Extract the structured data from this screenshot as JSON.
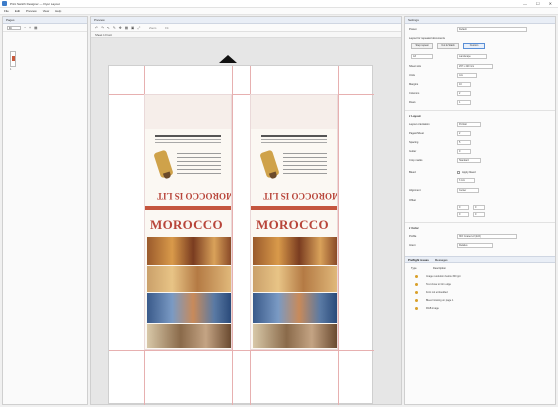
{
  "window": {
    "title": "Print Switch Designer — Flyer Layout",
    "controls": [
      "—",
      "☐",
      "✕"
    ]
  },
  "menu": [
    "File",
    "Edit",
    "Preview",
    "View",
    "Help"
  ],
  "pages_panel": {
    "title": "Pages",
    "zoom_value": "Fit",
    "thumb_label": "1"
  },
  "preview_panel": {
    "title": "Preview",
    "toolbar_glyphs": [
      "↶",
      "↷",
      "↖",
      "✎",
      "✥",
      "▦",
      "▣",
      "⤢"
    ],
    "zoom_label_a": "Zoom",
    "zoom_label_b": "Fit",
    "subbar_label": "Sheet 1 Front"
  },
  "flyers": [
    {
      "name": "flyer-left",
      "heading": "MOROCCO",
      "red_heading": "MOROCCO IS LIT"
    },
    {
      "name": "flyer-right",
      "heading": "MOROCCO",
      "red_heading": "MOROCCO IS LIT"
    }
  ],
  "props_panel": {
    "title": "Settings",
    "rows": [
      {
        "name": "preset-row",
        "label": "Preset",
        "value": "Default"
      },
      {
        "name": "layout-mode-row",
        "label": "Layout for repeated documents",
        "value": ""
      }
    ],
    "buttons": [
      "Step repeat",
      "Cut & Stack",
      "Custom"
    ],
    "sheet_selects": [
      "A3",
      "Landscape"
    ],
    "fields": [
      {
        "label": "Sheet size",
        "value": "297 x 420 mm"
      },
      {
        "label": "Units",
        "value": "mm"
      },
      {
        "label": "Margins",
        "value": "10"
      },
      {
        "label": "Columns",
        "value": "2"
      },
      {
        "label": "Rows",
        "value": "1"
      }
    ],
    "section_layout": "Layout",
    "layout_fields": [
      {
        "label": "Layout orientation",
        "value": "Portrait"
      },
      {
        "label": "Pages/Sheet",
        "value": "2"
      },
      {
        "label": "Spacing",
        "value": "5"
      },
      {
        "label": "Gutter",
        "value": "0"
      },
      {
        "label": "Crop marks",
        "value": "Standard"
      }
    ],
    "bleed_label": "Bleed",
    "bleed_check": "Apply bleed",
    "bleed_value": "3 mm",
    "align_label": "Alignment",
    "align_value": "Center",
    "margin_label": "Offset",
    "margin_values": [
      "0",
      "0",
      "0",
      "0"
    ],
    "section_color": "Color",
    "color_fields": [
      {
        "label": "Profile",
        "value": "ISO Coated v2 (ECI)"
      },
      {
        "label": "Intent",
        "value": "Relative"
      }
    ]
  },
  "issues_panel": {
    "tabs": [
      "Preflight issues",
      "Messages"
    ],
    "column_headers": [
      "Type",
      "Description"
    ],
    "rows": [
      "Image resolution below 300 ppi",
      "Text close to trim edge",
      "Font not embedded",
      "Bleed missing on page 1",
      "RGB image"
    ]
  }
}
